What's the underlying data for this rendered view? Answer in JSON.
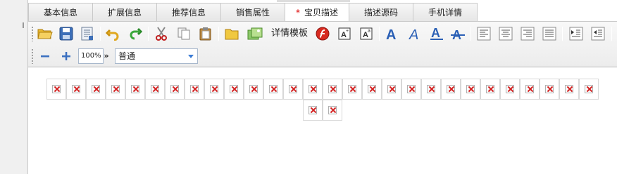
{
  "tabs": [
    {
      "label": "基本信息",
      "active": false,
      "modified": false
    },
    {
      "label": "扩展信息",
      "active": false,
      "modified": false
    },
    {
      "label": "推荐信息",
      "active": false,
      "modified": false
    },
    {
      "label": "销售属性",
      "active": false,
      "modified": false
    },
    {
      "label": "宝贝描述",
      "active": true,
      "modified": true,
      "marker": "*"
    },
    {
      "label": "描述源码",
      "active": false,
      "modified": false
    },
    {
      "label": "手机详情",
      "active": false,
      "modified": false
    }
  ],
  "toolbar": {
    "icons": [
      "open-folder-icon",
      "save-icon",
      "properties-icon",
      "undo-icon",
      "redo-icon",
      "cut-icon",
      "copy-icon",
      "paste-icon",
      "folder-icon",
      "insert-image-icon",
      "flash-icon",
      "text-box-icon",
      "text-box-alt-icon",
      "font-bold-a-icon",
      "font-italic-a-icon",
      "font-underline-a-icon",
      "font-strike-a-icon",
      "align-left-icon",
      "align-center-icon",
      "align-right-icon",
      "align-justify-icon",
      "indent-icon",
      "outdent-icon"
    ],
    "template_label": "详情模板",
    "zoom_value": "100%",
    "zoom_more": "»",
    "format_value": "普通",
    "zoom_out_icon": "minus-icon",
    "zoom_in_icon": "plus-icon"
  },
  "editor": {
    "broken_image_count_row1": 28,
    "broken_image_count_row2": 2
  },
  "colors": {
    "accent": "#1f5fb5",
    "broken_x": "#d42020",
    "modified_star": "#dd0000"
  }
}
